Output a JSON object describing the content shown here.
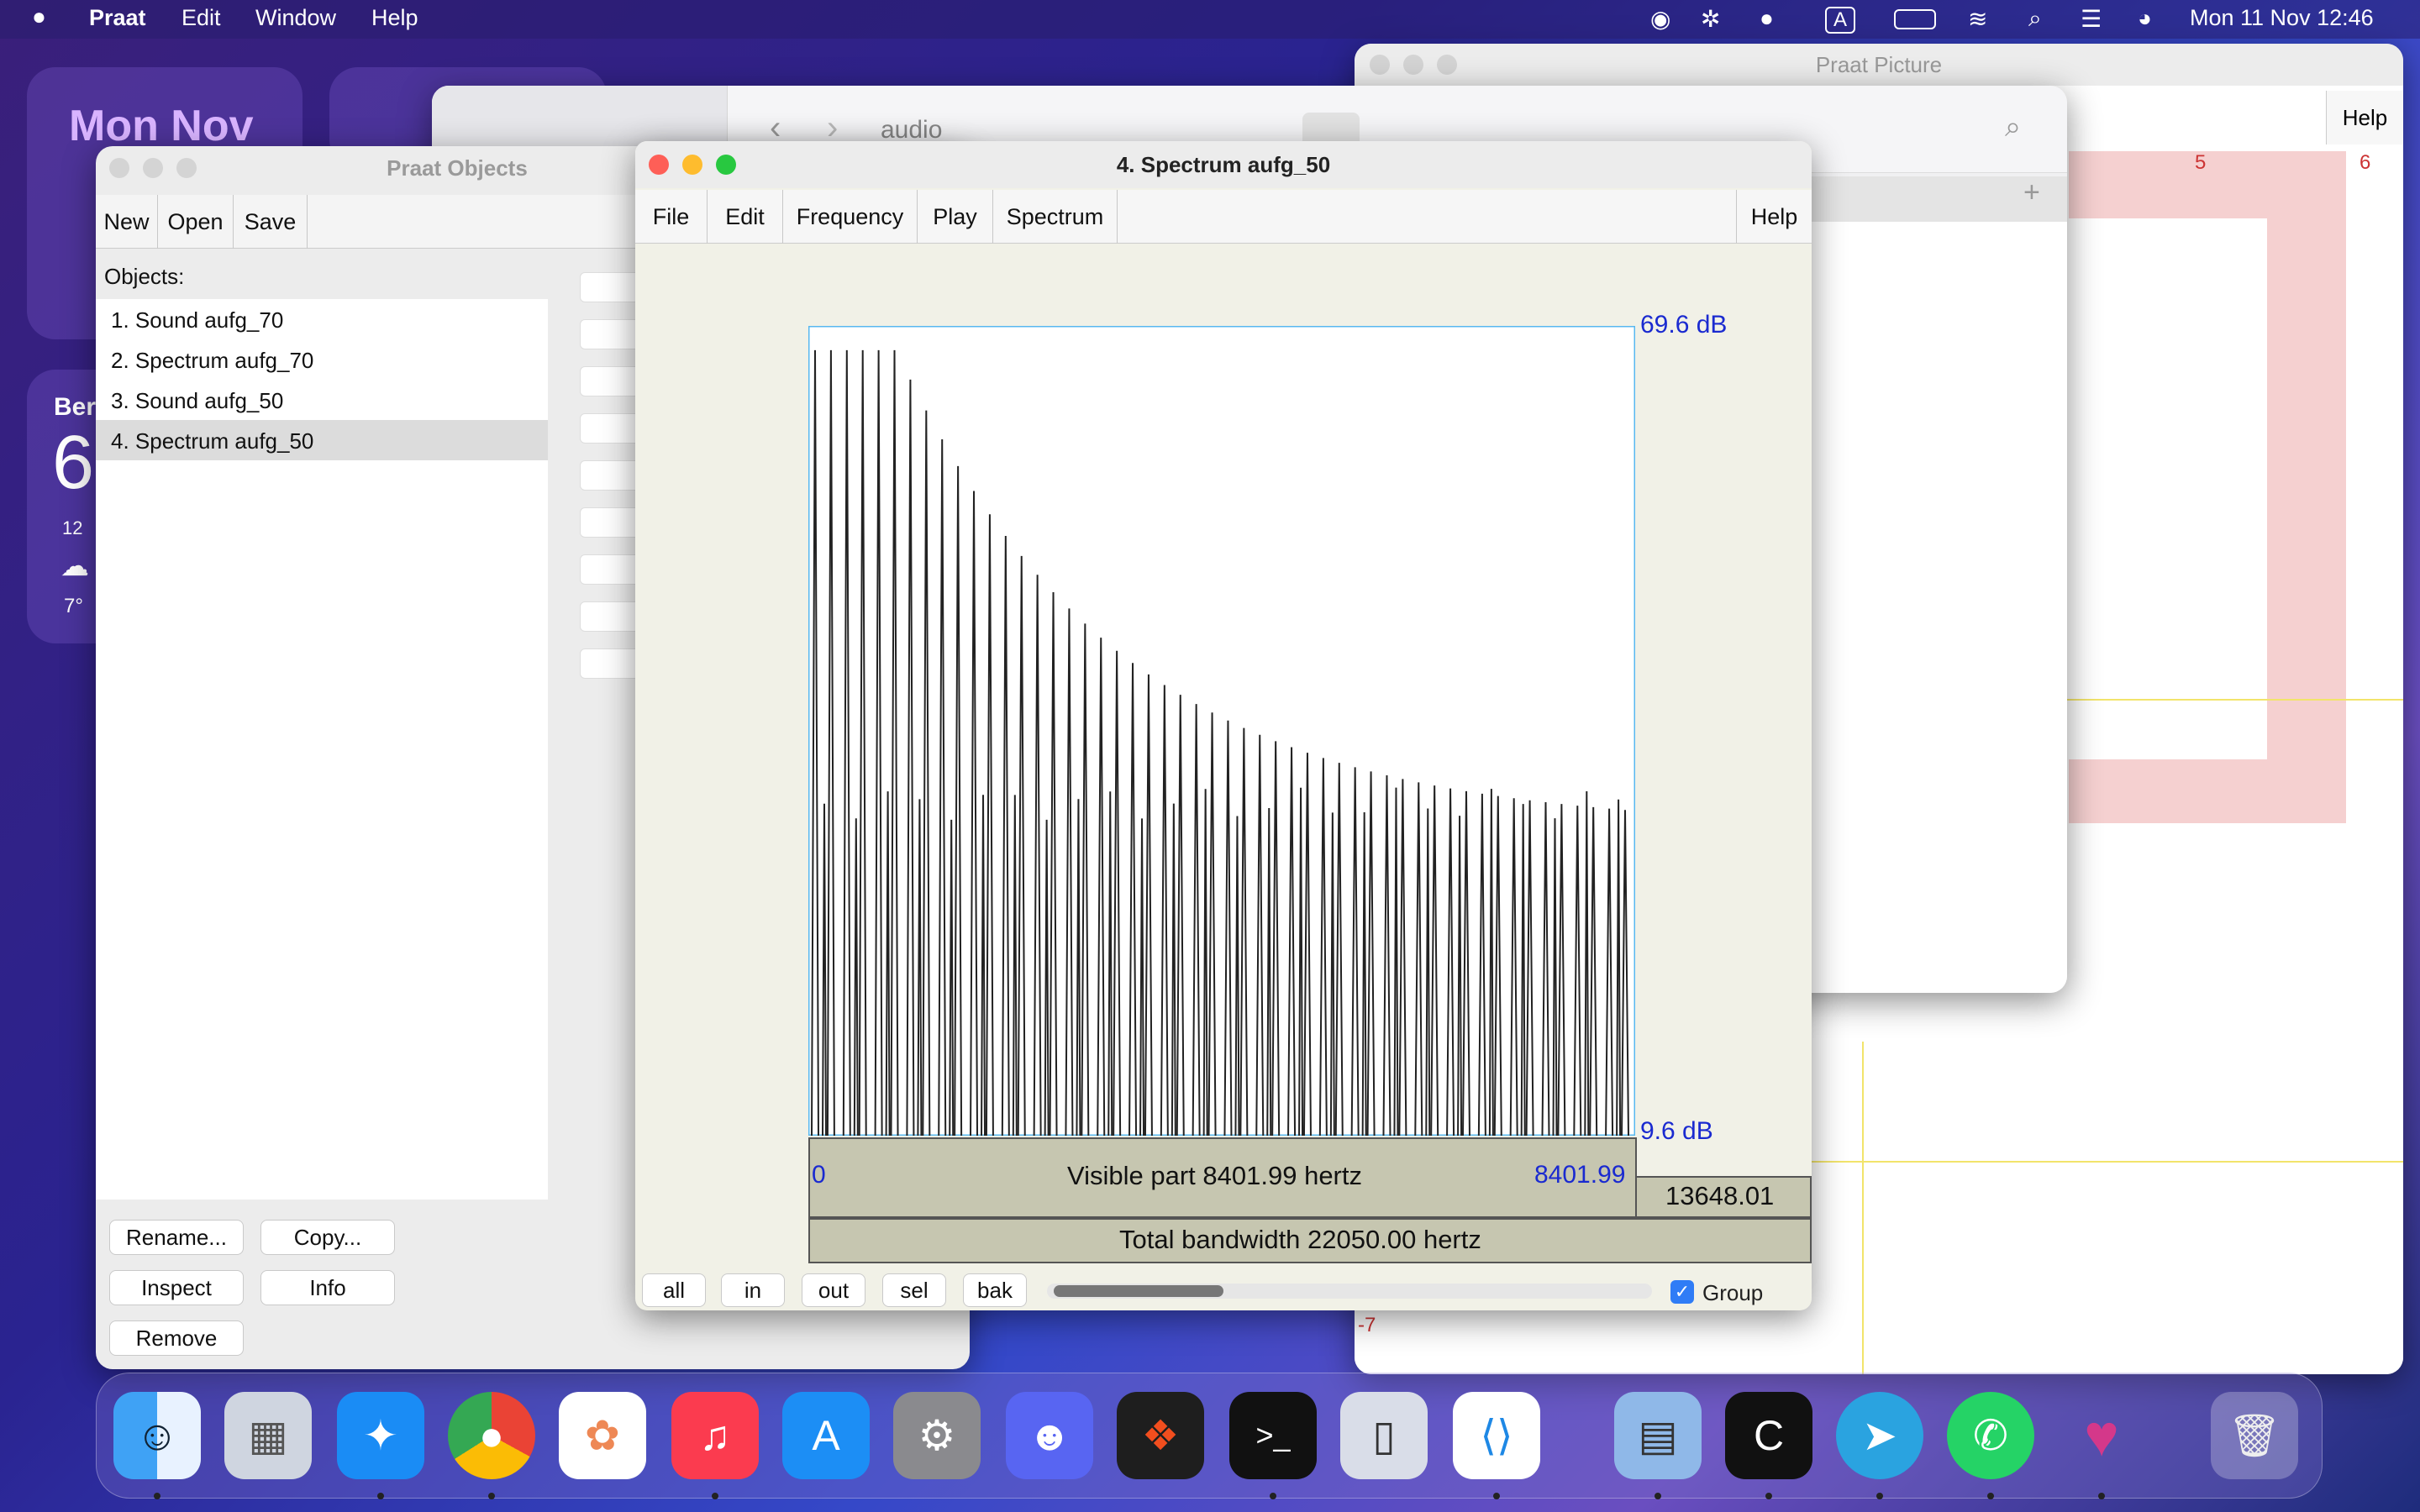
{
  "menubar": {
    "app": "Praat",
    "items": [
      "Edit",
      "Window",
      "Help"
    ],
    "datetime": "Mon 11 Nov  12:46",
    "input_source": "A"
  },
  "widgets": {
    "calendar": "Mon Nov",
    "weather_city": "Ber",
    "weather_temp": "6",
    "weather_hour": "12",
    "weather_low": "7°"
  },
  "finder": {
    "title": "audio"
  },
  "picture": {
    "title": "Praat Picture",
    "help": "Help",
    "ruler_5": "5",
    "ruler_6": "6",
    "neg7": "-7",
    "plus": "+"
  },
  "objects": {
    "title": "Praat Objects",
    "buttons": [
      "New",
      "Open",
      "Save"
    ],
    "label": "Objects:",
    "list": [
      "1. Sound aufg_70",
      "2. Spectrum aufg_70",
      "3. Sound aufg_50",
      "4. Spectrum aufg_50"
    ],
    "selected_index": 3,
    "rename": "Rename...",
    "copy": "Copy...",
    "inspect": "Inspect",
    "info": "Info",
    "remove": "Remove"
  },
  "spectrum": {
    "title": "4. Spectrum aufg_50",
    "menus": [
      "File",
      "Edit",
      "Frequency",
      "Play",
      "Spectrum"
    ],
    "help": "Help",
    "db_top": "69.6 dB",
    "db_bottom": "9.6 dB",
    "x_left": "0",
    "x_right": "8401.99",
    "visible": "Visible part 8401.99 hertz",
    "remaining": "13648.01",
    "total": "Total bandwidth 22050.00 hertz",
    "zoom": [
      "all",
      "in",
      "out",
      "sel",
      "bak"
    ],
    "group": "Group",
    "group_checked": true,
    "scroll_thumb": 0.28
  },
  "dock": {
    "apps": [
      "Finder",
      "Launchpad",
      "Safari",
      "Chrome",
      "Photos",
      "Music",
      "App Store",
      "System Settings",
      "Discord",
      "Figma",
      "Terminal",
      "iPhone Mirroring",
      "VS Code",
      "Preview",
      "Cursor",
      "Telegram",
      "WhatsApp",
      "Lips",
      "Trash"
    ]
  }
}
